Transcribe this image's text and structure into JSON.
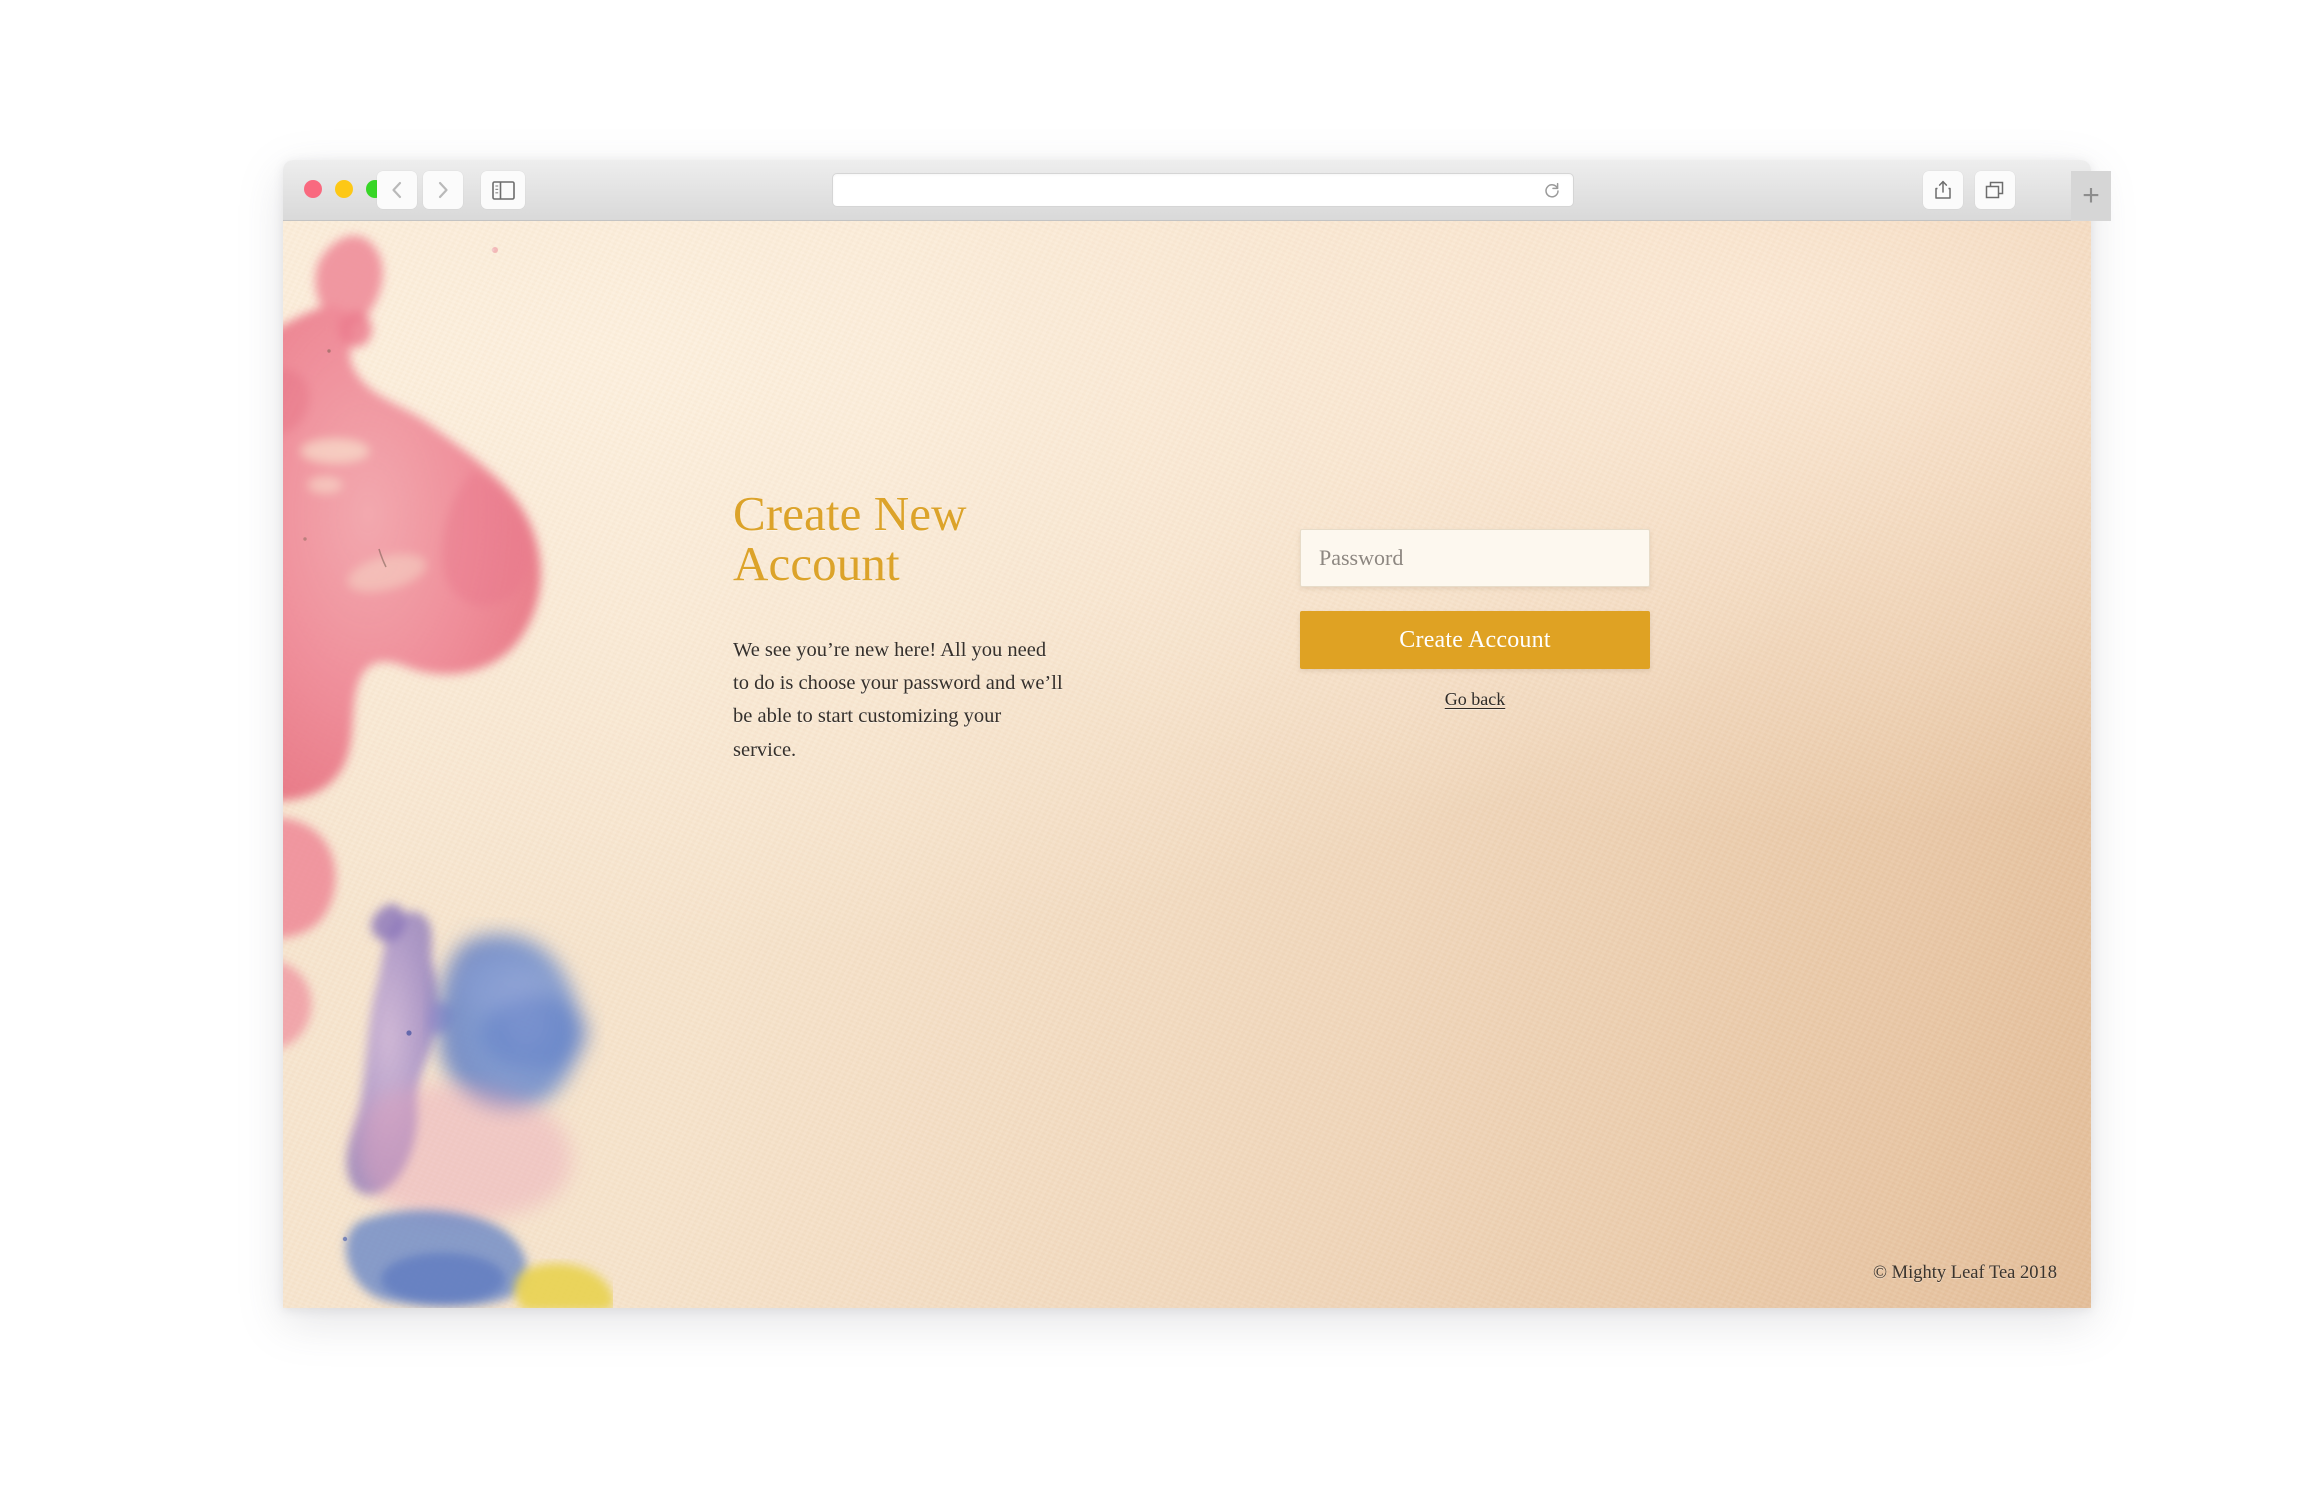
{
  "browser": {
    "traffic_lights": [
      "close",
      "minimize",
      "maximize"
    ],
    "back_label": "Back",
    "forward_label": "Forward",
    "sidebar_label": "Show Sidebar",
    "address_value": "",
    "address_placeholder": "",
    "reload_label": "Reload",
    "share_label": "Share",
    "tabs_label": "Show Tab Overview",
    "new_tab_label": "+"
  },
  "page": {
    "headline": "Create New Account",
    "subcopy": "We see you’re new here! All you need to do is choose your password and we’ll be able to start customizing your service.",
    "form": {
      "password_value": "",
      "password_placeholder": "Password",
      "submit_label": "Create Account",
      "back_link_label": "Go back"
    },
    "footer": "© Mighty Leaf Tea 2018"
  },
  "colors": {
    "accent": "#dfa223",
    "headline": "#dca32a",
    "page_bg": "#f2dcc0",
    "input_bg": "#fdf8ef",
    "body_text": "#35302c",
    "watercolor_pink": "#ee8292",
    "watercolor_blue": "#6f8ecd",
    "watercolor_purple": "#9b86c4",
    "watercolor_yellow": "#e8d14b"
  }
}
